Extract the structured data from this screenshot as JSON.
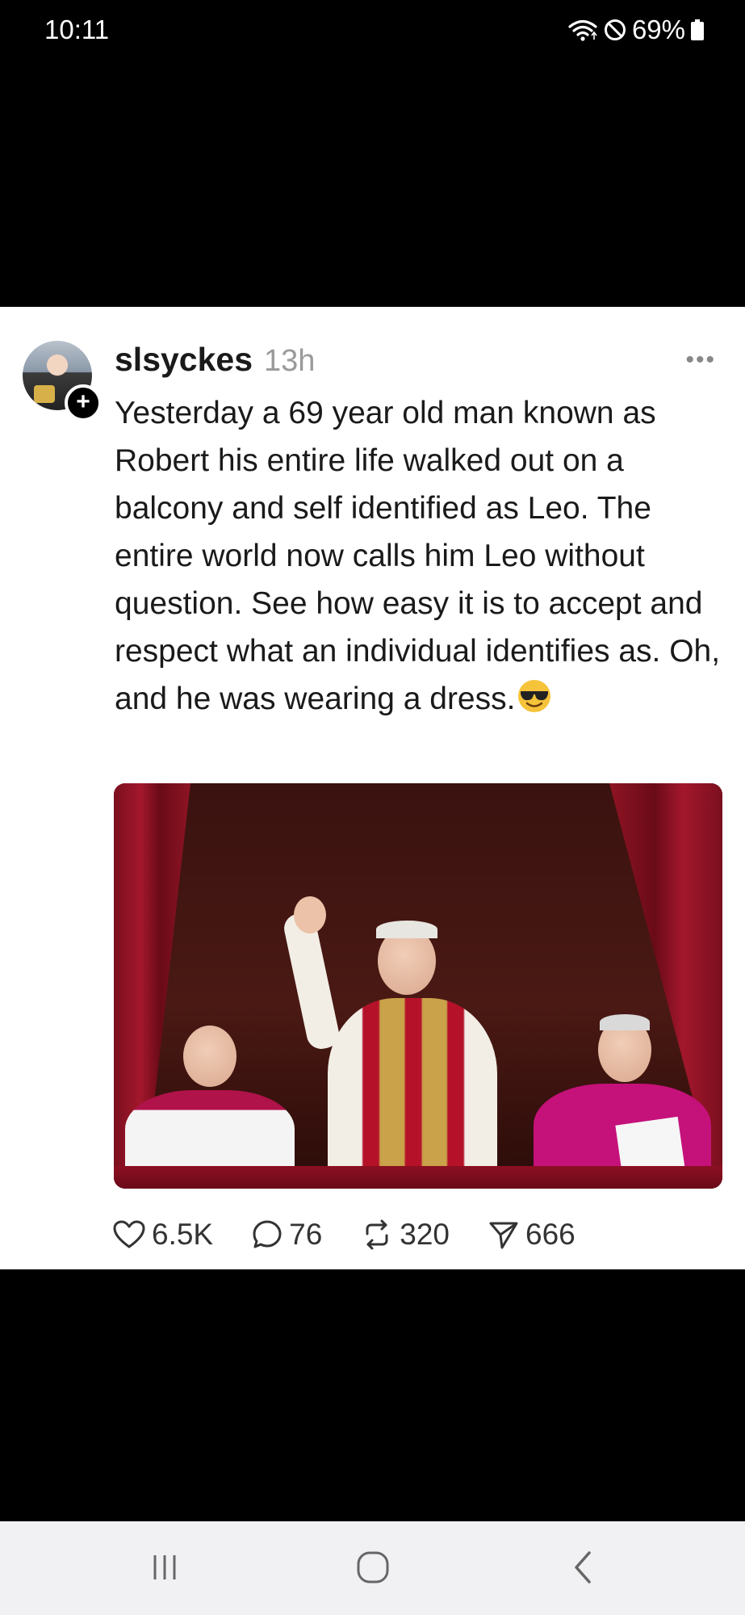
{
  "status_bar": {
    "time": "10:11",
    "battery": "69%",
    "icons": [
      "wifi-icon",
      "do-not-disturb-icon",
      "battery-icon"
    ]
  },
  "post": {
    "username": "slsyckes",
    "timestamp": "13h",
    "more_label": "•••",
    "follow_badge": "+",
    "text": "Yesterday a 69 year old man known as Robert his entire life walked out on a balcony and self identified as Leo. The entire world now calls him Leo without question. See how easy it is to accept and respect what an individual identifies as. Oh, and he was wearing a dress.",
    "emoji": "smiling-face-with-sunglasses",
    "image_description_icon": "photo"
  },
  "actions": {
    "likes": "6.5K",
    "comments": "76",
    "reposts": "320",
    "shares": "666"
  },
  "nav": {
    "icons": [
      "recent-apps-icon",
      "home-icon",
      "back-icon"
    ]
  },
  "colors": {
    "card_bg": "#ffffff",
    "screen_bg": "#000000",
    "text": "#1a1a1a",
    "muted": "#9a9a9a",
    "nav_bg": "#f1f1f3"
  }
}
